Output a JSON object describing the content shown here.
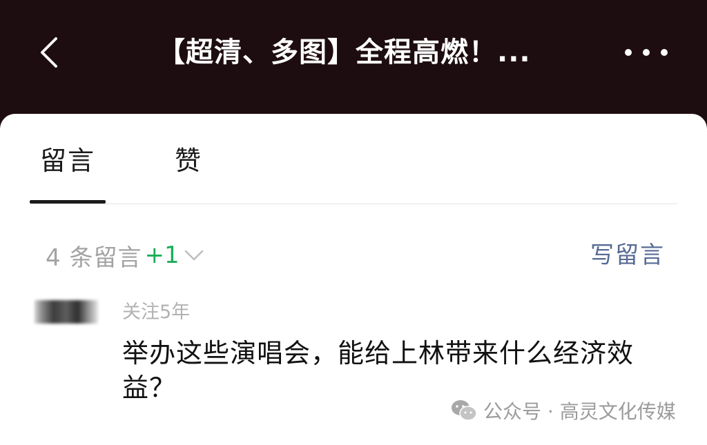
{
  "header": {
    "title": "【超清、多图】全程高燃！...",
    "back_icon": "chevron-left-icon",
    "more_icon": "more-dots-icon"
  },
  "tabs": [
    {
      "label": "留言",
      "active": true
    },
    {
      "label": "赞",
      "active": false
    }
  ],
  "comments_bar": {
    "count_label": "4 条留言",
    "delta": "+1",
    "write_label": "写留言"
  },
  "comments": [
    {
      "follow_duration": "关注5年",
      "text": "举办这些演唱会，能给上林带来什么经济效益？"
    }
  ],
  "watermark": {
    "text": "公众号 · 高灵文化传媒",
    "icon": "wechat-icon"
  },
  "colors": {
    "header_bg": "#1e0d10",
    "accent_green": "#1aad5a",
    "link_blue": "#576b95"
  }
}
